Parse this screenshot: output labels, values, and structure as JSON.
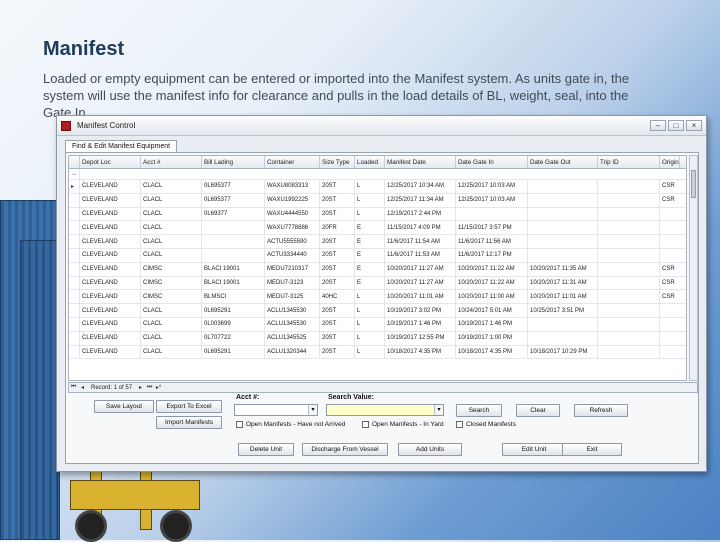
{
  "slide": {
    "title": "Manifest",
    "body": "Loaded or empty equipment can be entered or imported into the Manifest system. As units gate in, the system will use the manifest info for clearance and pulls in the load details of BL, weight, seal, into the Gate In."
  },
  "window": {
    "title": "Manifest Control",
    "buttons": {
      "minimize": "–",
      "maximize": "□",
      "close": "×"
    },
    "tab": "Find & Edit Manifest Equipment"
  },
  "grid": {
    "columns": [
      "Depot Loc",
      "Acct #",
      "Bill Lading",
      "Container",
      "Size Type",
      "Loaded",
      "Manifest Date",
      "Date Gate In",
      "Date Gate Out",
      "Trip ID",
      "Origin"
    ],
    "filter_marker": "→",
    "current_marker": "▸",
    "rows": [
      [
        "CLEVELAND",
        "CLACL",
        "0L695377",
        "WAXU8083313",
        "20ST",
        "L",
        "12/25/2017 10:34 AM",
        "12/25/2017 10:03 AM",
        "",
        "",
        "CSR"
      ],
      [
        "CLEVELAND",
        "CLACL",
        "0L695377",
        "WAXU1992225",
        "20ST",
        "L",
        "12/25/2017 11:34 AM",
        "12/25/2017 10:03 AM",
        "",
        "",
        "CSR"
      ],
      [
        "CLEVELAND",
        "CLACL",
        "0L69377",
        "WAXU4444550",
        "20ST",
        "L",
        "12/19/2017 2:44 PM",
        "",
        "",
        "",
        ""
      ],
      [
        "CLEVELAND",
        "CLACL",
        "",
        "WAXU7778886",
        "20FR",
        "E",
        "11/15/2017 4:09 PM",
        "11/15/2017 3:57 PM",
        "",
        "",
        ""
      ],
      [
        "CLEVELAND",
        "CLACL",
        "",
        "ACTU5555590",
        "20ST",
        "E",
        "11/6/2017 11:54 AM",
        "11/6/2017 11:56 AM",
        "",
        "",
        ""
      ],
      [
        "CLEVELAND",
        "CLACL",
        "",
        "ACTU3334440",
        "20ST",
        "E",
        "11/6/2017 11:53 AM",
        "11/6/2017 12:17 PM",
        "",
        "",
        ""
      ],
      [
        "CLEVELAND",
        "CIMSC",
        "BLACI 19001",
        "MEDU7210317",
        "20ST",
        "E",
        "10/20/2017 11:27 AM",
        "10/20/2017 11:22 AM",
        "10/20/2017 11:35 AM",
        "",
        "CSR"
      ],
      [
        "CLEVELAND",
        "CIMSC",
        "BLACI 19001",
        "MEDU7-3123",
        "20ST",
        "E",
        "10/20/2017 11:27 AM",
        "10/20/2017 11:22 AM",
        "10/20/2017 11:31 AM",
        "",
        "CSR"
      ],
      [
        "CLEVELAND",
        "CIMSC",
        "BLMSCI",
        "MEDU7-3125",
        "40HC",
        "L",
        "10/20/2017 11:01 AM",
        "10/20/2017 11:00 AM",
        "10/20/2017 11:01 AM",
        "",
        "CSR"
      ],
      [
        "CLEVELAND",
        "CLACL",
        "0L695291",
        "ACLU1345530",
        "20ST",
        "L",
        "10/19/2017 3:02 PM",
        "10/24/2017 5:01 AM",
        "10/25/2017 3:51 PM",
        "",
        ""
      ],
      [
        "CLEVELAND",
        "CLACL",
        "0L003699",
        "ACLU1345530",
        "20ST",
        "L",
        "10/19/2017 1:46 PM",
        "10/19/2017 1:46 PM",
        "",
        "",
        ""
      ],
      [
        "CLEVELAND",
        "CLACL",
        "0L707722",
        "ACLU1345525",
        "20ST",
        "L",
        "10/19/2017 12:55 PM",
        "10/19/2017 1:00 PM",
        "",
        "",
        ""
      ],
      [
        "CLEVELAND",
        "CLACL",
        "0L695291",
        "ACLU1320344",
        "20ST",
        "L",
        "10/18/2017 4:35 PM",
        "10/18/2017 4:35 PM",
        "10/18/2017 10:29 PM",
        "",
        ""
      ]
    ]
  },
  "navigator": {
    "first": "⏮",
    "prev": "◂",
    "record_text": "Record: 1 of 57",
    "next": "▸",
    "last": "⏭",
    "new": "▸*"
  },
  "controls": {
    "acct_label": "Acct #:",
    "search_label": "Search Value:",
    "acct_value": "",
    "search_value": "",
    "dropdown_arrow": "▾",
    "save_layout": "Save Layout",
    "export_excel": "Export To Excel",
    "import_manifests": "Import Manifests",
    "search": "Search",
    "clear": "Clear",
    "refresh": "Refresh",
    "check_open_not_arrived": "Open Manifests - Have not Arrived",
    "check_open_in_yard": "Open Manifests - In Yard",
    "check_closed": "Closed Manifests",
    "delete_unit": "Delete Unit",
    "discharge_vessel": "Discharge From Vessel",
    "add_units": "Add Units",
    "edit_unit": "Edit Unit",
    "exit": "Exit"
  }
}
